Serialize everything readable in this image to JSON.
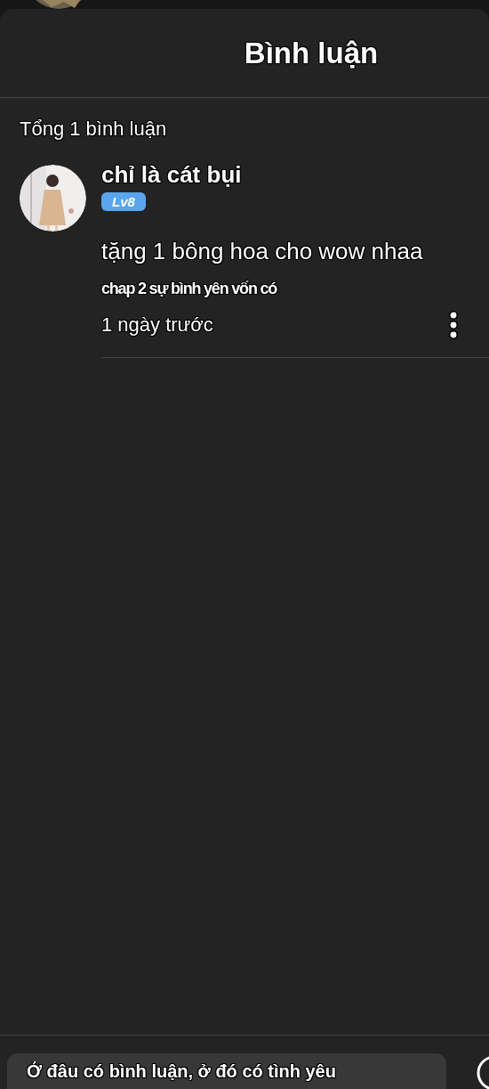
{
  "header": {
    "title": "Bình luận"
  },
  "summary": "Tổng 1 bình luận",
  "comments": [
    {
      "author": "chỉ là cát bụi",
      "level_badge": "Lv8",
      "text": "tặng 1 bông hoa cho wow nhaa",
      "chapter": "chap 2 sự bình yên vốn có",
      "time": "1 ngày trước"
    }
  ],
  "composer": {
    "placeholder": "Ở đâu có bình luận, ở đó có tình yêu"
  }
}
